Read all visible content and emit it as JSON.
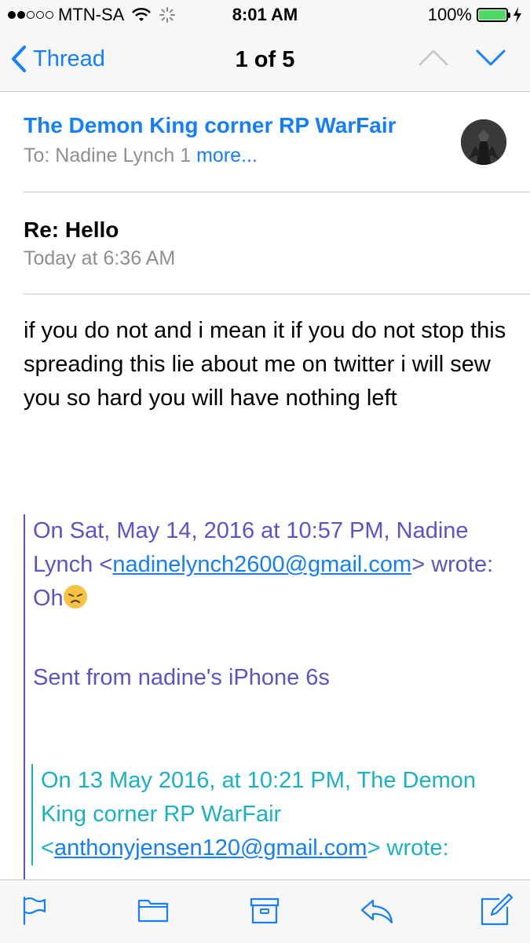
{
  "status_bar": {
    "carrier": "MTN-SA",
    "time": "8:01 AM",
    "battery_percent": "100%",
    "signal_icon": "signal-dots-icon",
    "wifi_icon": "wifi-icon",
    "activity_icon": "activity-spinner-icon",
    "charging_icon": "charging-bolt-icon"
  },
  "nav": {
    "back_label": "Thread",
    "title": "1 of 5"
  },
  "header": {
    "sender": "The Demon King corner RP WarFair",
    "to_prefix": "To: Nadine Lynch 1",
    "more_link": "more..."
  },
  "message": {
    "subject": "Re: Hello",
    "date": "Today at 6:36 AM",
    "body": "if you do not and i mean it if you do not stop this spreading this lie about me on twitter i will sew you so hard you will have nothing left"
  },
  "quote1": {
    "intro": "On Sat, May 14, 2016 at 10:57 PM, Nadine Lynch <",
    "email": "nadinelynch2600@gmail.com",
    "outro": "> wrote:",
    "line1": "Oh",
    "line2": "Sent from nadine's iPhone 6s"
  },
  "quote2": {
    "intro": "On 13 May 2016, at 10:21 PM, The Demon King corner RP WarFair",
    "lt": "<",
    "email": "anthonyjensen120@gmail.com",
    "outro": "> wrote:"
  },
  "colors": {
    "accent": "#157efb",
    "quote1": "#5b54c8",
    "quote2": "#1bb0c4",
    "battery": "#4cd964"
  }
}
